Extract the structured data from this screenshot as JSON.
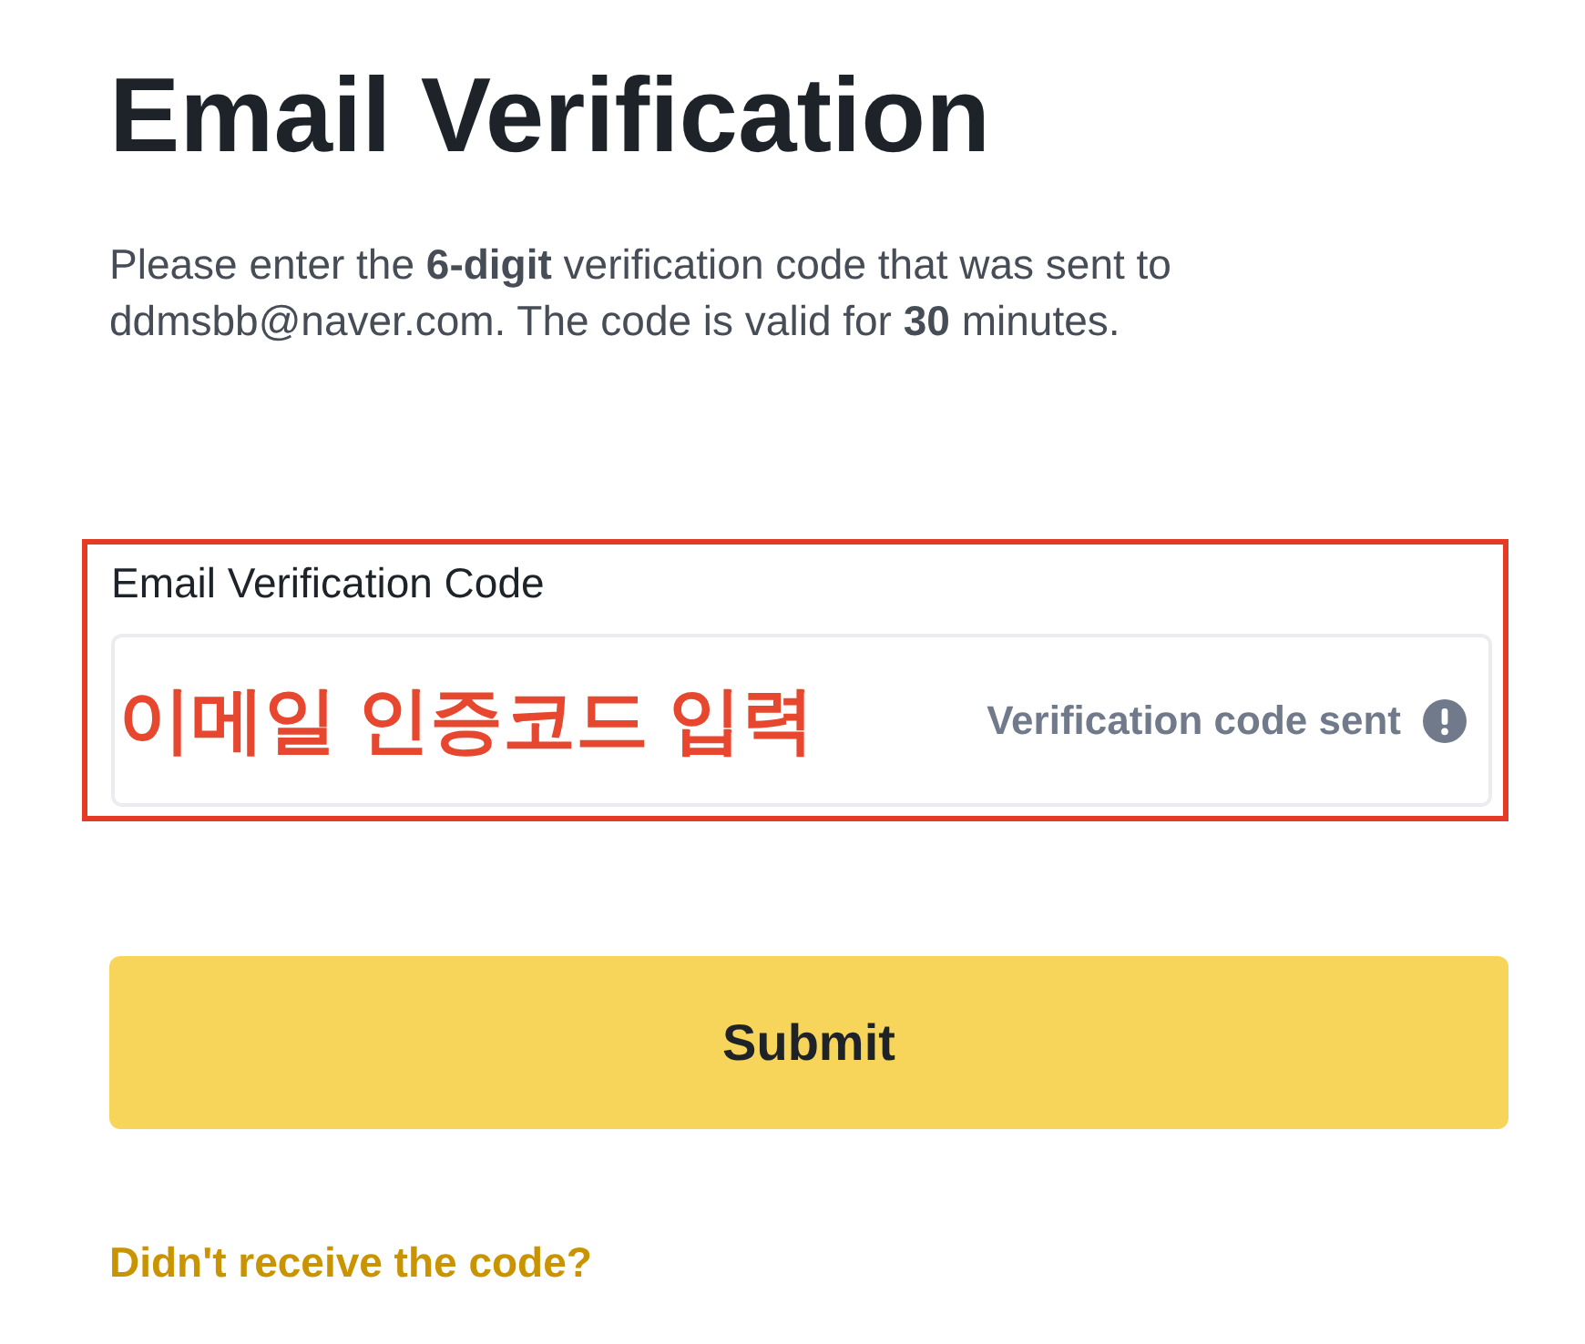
{
  "title": "Email Verification",
  "description": "Please enter the **6-digit** verification code that was sent to ddmsbb@naver.com. The code is valid for **30** minutes.",
  "field": {
    "label": "Email Verification Code",
    "annotation": "이메일 인증코드 입력",
    "status": "Verification code sent",
    "highlighted": true
  },
  "submit": {
    "label": "Submit"
  },
  "link": {
    "label": "Didn't receive the code?"
  }
}
